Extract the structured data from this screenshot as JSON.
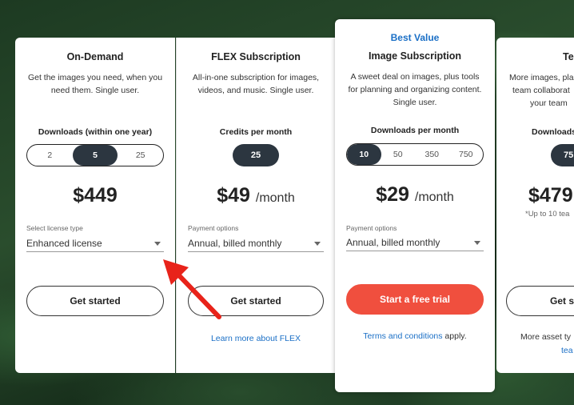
{
  "cards": [
    {
      "title": "On-Demand",
      "desc": "Get the images you need, when you need them. Single user.",
      "selector_label": "Downloads (within one year)",
      "options": [
        "2",
        "5",
        "25"
      ],
      "selected": "5",
      "price": "$449",
      "field_label": "Select license type",
      "field_value": "Enhanced license",
      "button": "Get started"
    },
    {
      "title": "FLEX Subscription",
      "desc": "All-in-one subscription for images, videos, and music. Single user.",
      "selector_label": "Credits per month",
      "options": [
        "25"
      ],
      "selected": "25",
      "price": "$49",
      "per": "/month",
      "field_label": "Payment options",
      "field_value": "Annual, billed monthly",
      "button": "Get started",
      "link": "Learn more about FLEX"
    },
    {
      "badge": "Best Value",
      "title": "Image Subscription",
      "desc": "A sweet deal on images, plus tools for planning and organizing content. Single user.",
      "selector_label": "Downloads per month",
      "options": [
        "10",
        "50",
        "350",
        "750"
      ],
      "selected": "10",
      "price": "$29",
      "per": "/month",
      "field_label": "Payment options",
      "field_value": "Annual, billed monthly",
      "button": "Start a free trial",
      "link": "Terms and conditions",
      "link_suffix": " apply."
    },
    {
      "title": "Te",
      "desc_lines": [
        "More images, pla",
        "team collaborat",
        "your team"
      ],
      "selector_label": "Downloads",
      "selected": "75",
      "price": "$479",
      "note": "*Up to 10 tea",
      "button": "Get st",
      "footer_line1": "More asset ty",
      "footer_line2": "tea"
    }
  ],
  "colors": {
    "accent_blue": "#1a6fc6",
    "cta_red": "#f04f3e",
    "selected_dark": "#2c3640",
    "arrow_red": "#e8231a"
  },
  "icons": {
    "dropdown": "caret-down-icon",
    "pointer": "red-arrow-annotation"
  }
}
